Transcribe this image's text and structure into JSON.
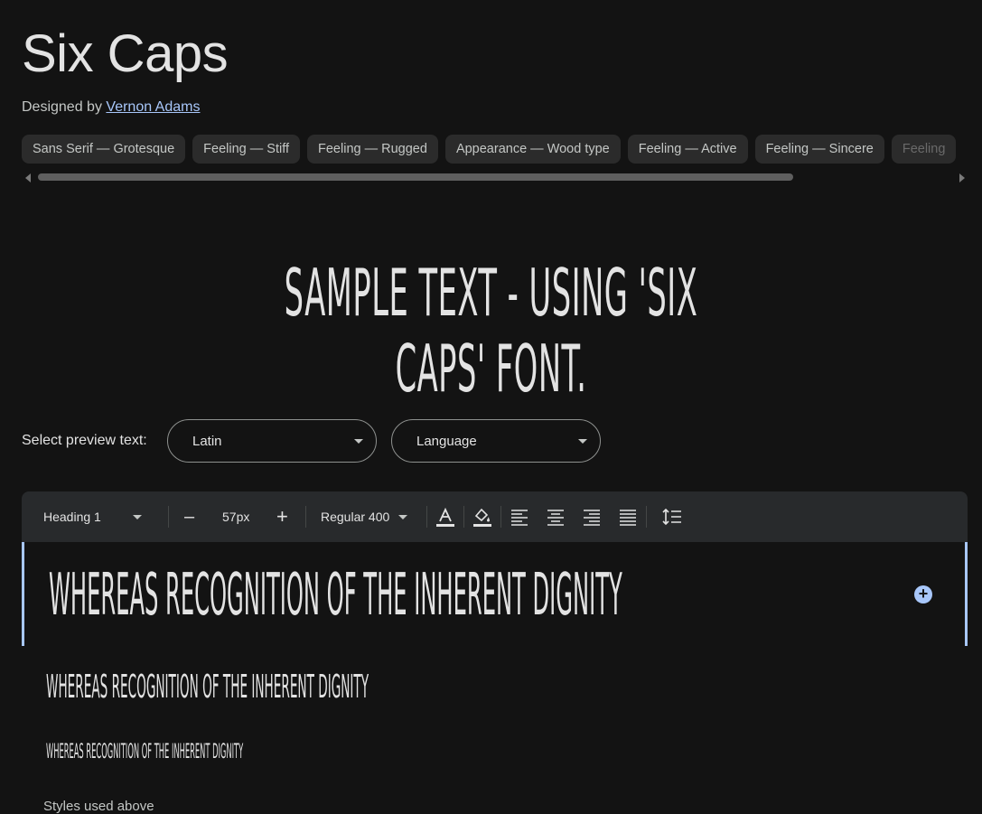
{
  "font": {
    "name": "Six Caps",
    "designed_by_label": "Designed by",
    "designer": "Vernon Adams"
  },
  "tags": [
    "Sans Serif — Grotesque",
    "Feeling — Stiff",
    "Feeling — Rugged",
    "Appearance — Wood type",
    "Feeling — Active",
    "Feeling — Sincere",
    "Feeling"
  ],
  "sample_text": "Sample Text - Using 'Six Caps' Font.",
  "preview": {
    "label": "Select preview text:",
    "script_value": "Latin",
    "language_value": "Language"
  },
  "toolbar": {
    "style": "Heading 1",
    "decrease": "–",
    "size": "57px",
    "increase": "+",
    "weight": "Regular 400"
  },
  "editor": {
    "heading1": "Whereas recognition of the inherent dignity",
    "heading2": "Whereas recognition of the inherent dignity",
    "heading3": "Whereas recognition of the inherent dignity",
    "add_button": "+"
  },
  "styles_used_label": "Styles used above",
  "colors": {
    "background": "#131313",
    "accent": "#a8c7fa",
    "toolbar": "#282a2c",
    "chip": "#2b2b2b"
  }
}
